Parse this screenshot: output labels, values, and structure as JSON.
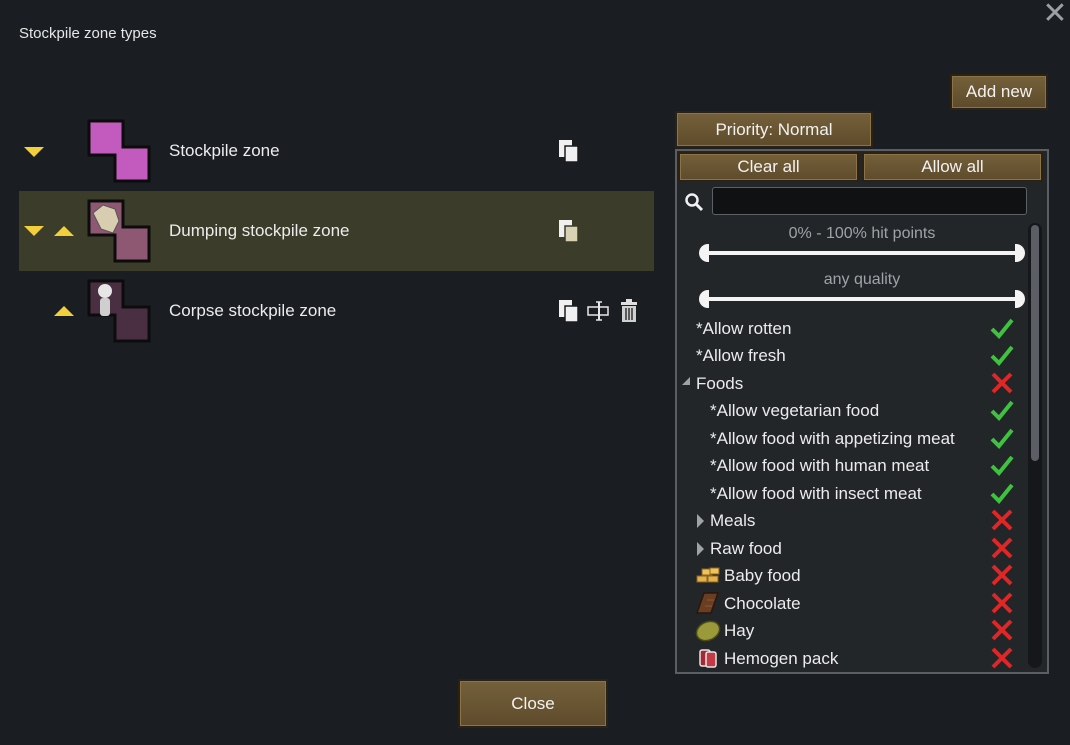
{
  "dialog": {
    "title": "Stockpile zone types"
  },
  "zones": [
    {
      "label": "Stockpile zone",
      "selected": false,
      "color": "#c25bbd"
    },
    {
      "label": "Dumping stockpile zone",
      "selected": true,
      "color": "#8e5873"
    },
    {
      "label": "Corpse stockpile zone",
      "selected": false,
      "color": "#4a2f42"
    }
  ],
  "buttons": {
    "add_new": "Add new",
    "priority": "Priority: Normal",
    "clear_all": "Clear all",
    "allow_all": "Allow all",
    "close": "Close"
  },
  "filter": {
    "search_placeholder": "",
    "hit_points_label": "0% - 100% hit points",
    "quality_label": "any quality",
    "items": [
      {
        "label": "*Allow rotten",
        "state": "allowed"
      },
      {
        "label": "*Allow fresh",
        "state": "allowed"
      },
      {
        "label": "Foods",
        "state": "disallowed",
        "expander": "expanded"
      },
      {
        "label": "*Allow vegetarian food",
        "state": "allowed"
      },
      {
        "label": "*Allow food with appetizing meat",
        "state": "allowed"
      },
      {
        "label": "*Allow food with human meat",
        "state": "allowed"
      },
      {
        "label": "*Allow food with insect meat",
        "state": "allowed"
      },
      {
        "label": "Meals",
        "state": "disallowed",
        "expander": "collapsed"
      },
      {
        "label": "Raw food",
        "state": "disallowed",
        "expander": "collapsed"
      },
      {
        "label": "Baby food",
        "state": "disallowed",
        "icon": "baby-food-icon"
      },
      {
        "label": "Chocolate",
        "state": "disallowed",
        "icon": "chocolate-icon"
      },
      {
        "label": "Hay",
        "state": "disallowed",
        "icon": "hay-icon"
      },
      {
        "label": "Hemogen pack",
        "state": "disallowed",
        "icon": "hemogen-pack-icon"
      }
    ]
  },
  "colors": {
    "check": "#3fc23f",
    "cross": "#e02626",
    "arrow": "#f3cf3b",
    "button": "#6a5633"
  }
}
